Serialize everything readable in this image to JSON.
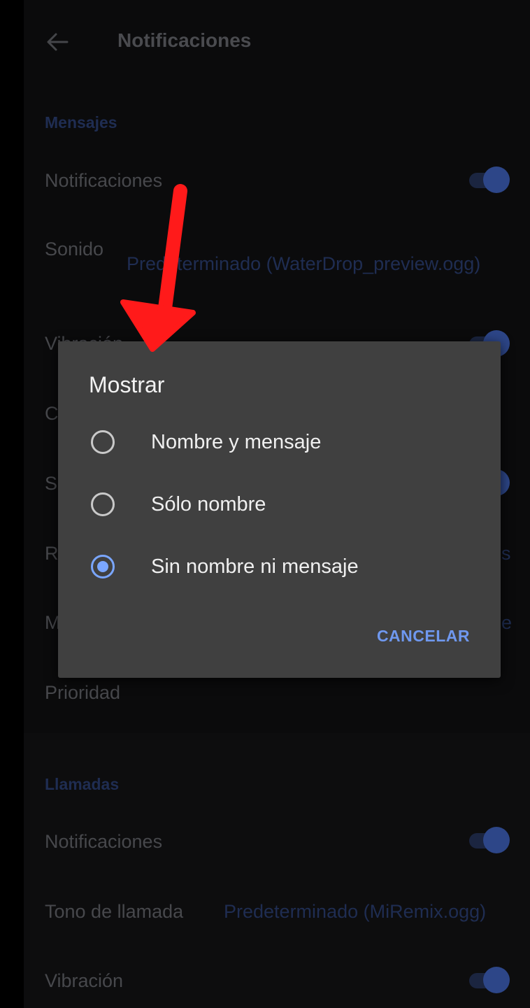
{
  "appbar": {
    "back_icon": "arrow-left-icon",
    "title": "Notificaciones"
  },
  "messages": {
    "header": "Mensajes",
    "notifications_label": "Notificaciones",
    "notifications_on": true,
    "sound_label": "Sonido",
    "sound_value": "Predeterminado (WaterDrop_preview.ogg)",
    "vibration_label": "Vibración",
    "vibration_on": true,
    "row4_label_visible": "C",
    "row5_label_visible": "S",
    "row5_on": true,
    "row6_label_visible": "R",
    "row6_value_visible": "s",
    "row7_label_visible": "M",
    "row7_value_visible": "e",
    "priority_label": "Prioridad"
  },
  "calls": {
    "header": "Llamadas",
    "notifications_label": "Notificaciones",
    "notifications_on": true,
    "ringtone_label": "Tono de llamada",
    "ringtone_value": "Predeterminado (MiRemix.ogg)",
    "vibration_label": "Vibración",
    "vibration_on": true
  },
  "dialog": {
    "title": "Mostrar",
    "options": [
      {
        "label": "Nombre y mensaje",
        "selected": false
      },
      {
        "label": "Sólo nombre",
        "selected": false
      },
      {
        "label": "Sin nombre ni mensaje",
        "selected": true
      }
    ],
    "cancel_label": "CANCELAR"
  },
  "colors": {
    "dialog_bg": "#404040",
    "accent": "#7aa6ff",
    "annotation_arrow": "#ff1a1a"
  }
}
